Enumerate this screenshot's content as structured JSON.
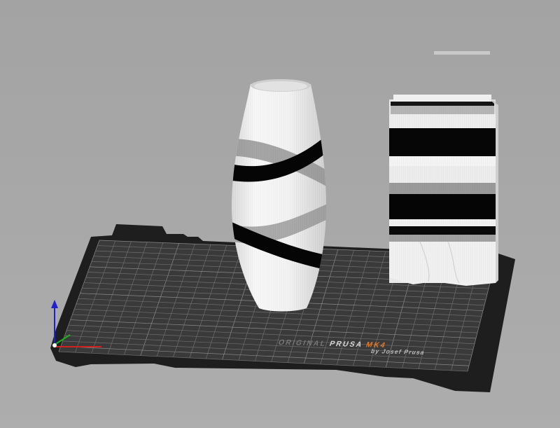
{
  "bed": {
    "brand_prefix": "ORIGINAL",
    "brand_name": "PRUSA",
    "brand_model": "MK4",
    "byline": "by Josef Prusa"
  },
  "objects": [
    "vase",
    "striped-box"
  ],
  "colors": {
    "background": "#a6a6a6",
    "bed_surface": "#3a3a3a",
    "bed_grid": "#7a7a7a",
    "model_white": "#f2f2f2",
    "model_black": "#050505",
    "model_gray": "#a8a8a8",
    "axis_x": "#d02020",
    "axis_y": "#20b020",
    "axis_z": "#2020d0",
    "brand_accent": "#e07a2a"
  }
}
